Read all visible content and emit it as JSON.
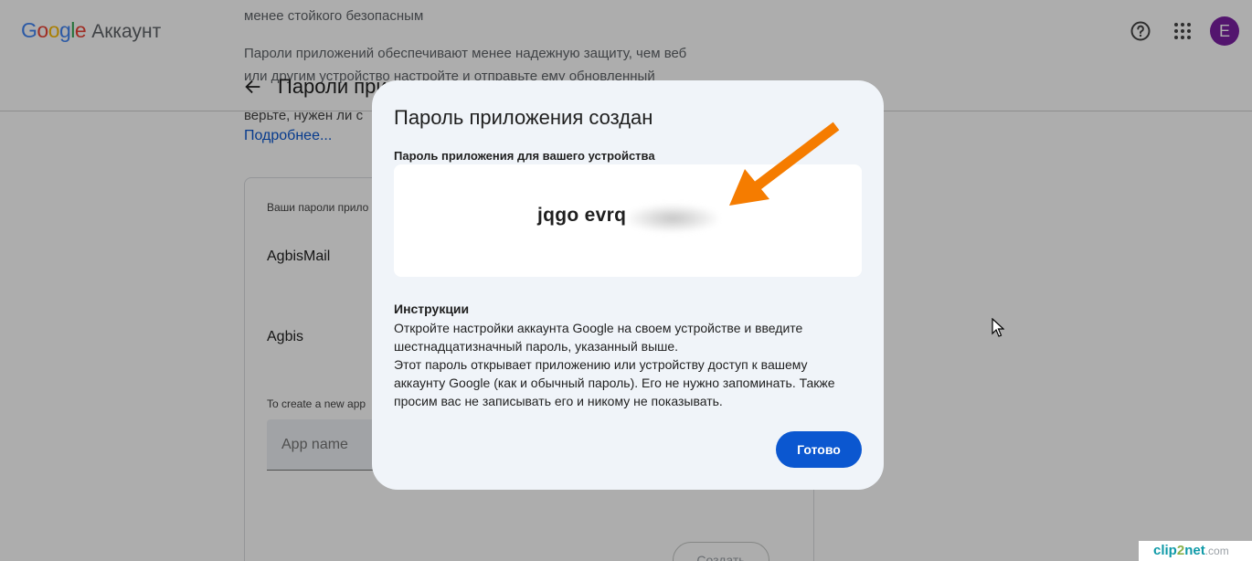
{
  "header": {
    "logo_letters": [
      "G",
      "o",
      "o",
      "g",
      "l",
      "e"
    ],
    "logo_colors": [
      "#4285F4",
      "#EA4335",
      "#FBBC05",
      "#4285F4",
      "#34A853",
      "#EA4335"
    ],
    "product": "Аккаунт",
    "avatar_letter": "E",
    "help_icon": "help-circle-icon",
    "apps_icon": "apps-grid-icon"
  },
  "background": {
    "faint_text_1": "менее стойкого безопасным",
    "faint_text_2": "Пароли приложений обеспечивают менее надежную защиту, чем веб",
    "faint_text_3": "или другим устройство настройте и отправьте ему обновленный",
    "page_title": "Пароли при",
    "text_1": "верьте, нужен ли с",
    "learn_more": "Подробнее...",
    "card_label": "Ваши пароли прило",
    "apps": [
      "AgbisMail",
      "Agbis"
    ],
    "create_label": "To create a new app",
    "app_name_placeholder": "App name",
    "create_button": "Создать"
  },
  "dialog": {
    "title": "Пароль приложения создан",
    "subtitle": "Пароль приложения для вашего устройства",
    "password_visible": "jqgo evrq",
    "instructions_heading": "Инструкции",
    "instructions_1": "Откройте настройки аккаунта Google на своем устройстве и введите шестнадцатизначный пароль, указанный выше.",
    "instructions_2": "Этот пароль открывает приложению или устройству доступ к вашему аккаунту Google (как и обычный пароль). Его не нужно запоминать. Также просим вас не записывать его и никому не показывать.",
    "done_button": "Готово",
    "accent_color": "#0b57d0"
  },
  "annotation": {
    "arrow_color": "#f57c00"
  },
  "watermark": {
    "part1": "clip",
    "part2": "2",
    "part3": "net",
    "part4": ".com"
  }
}
